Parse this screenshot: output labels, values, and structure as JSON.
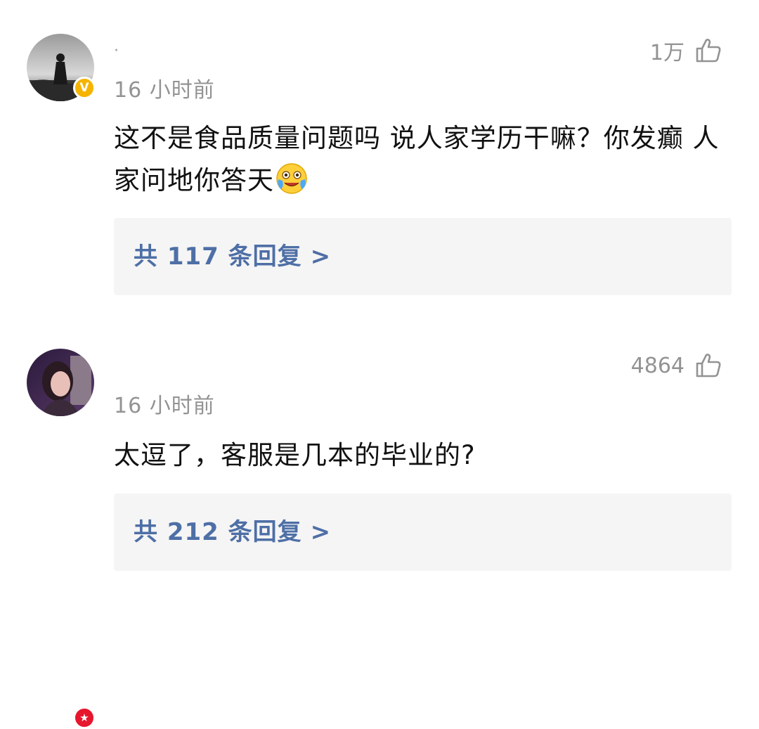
{
  "comments": [
    {
      "username": "·",
      "time": "16 小时前",
      "likes": "1万",
      "text": "这不是食品质量问题吗 说人家学历干嘛？你发癫 人家问地你答天",
      "emoji": "crying-laughing-emoji",
      "badge": "V",
      "badge_color": "#f5b400",
      "replies_label": "共 117 条回复",
      "replies_chevron": ">"
    },
    {
      "username": "",
      "time": "16 小时前",
      "likes": "4864",
      "text": "太逗了，客服是几本的毕业的?",
      "badge": "★",
      "badge_color": "#e6162d",
      "replies_label": "共 212 条回复",
      "replies_chevron": ">"
    }
  ],
  "colors": {
    "link": "#4e6fa6",
    "meta": "#939393",
    "reply_bg": "#f5f5f5"
  },
  "icons": {
    "like": "thumbs-up-outline-icon"
  }
}
